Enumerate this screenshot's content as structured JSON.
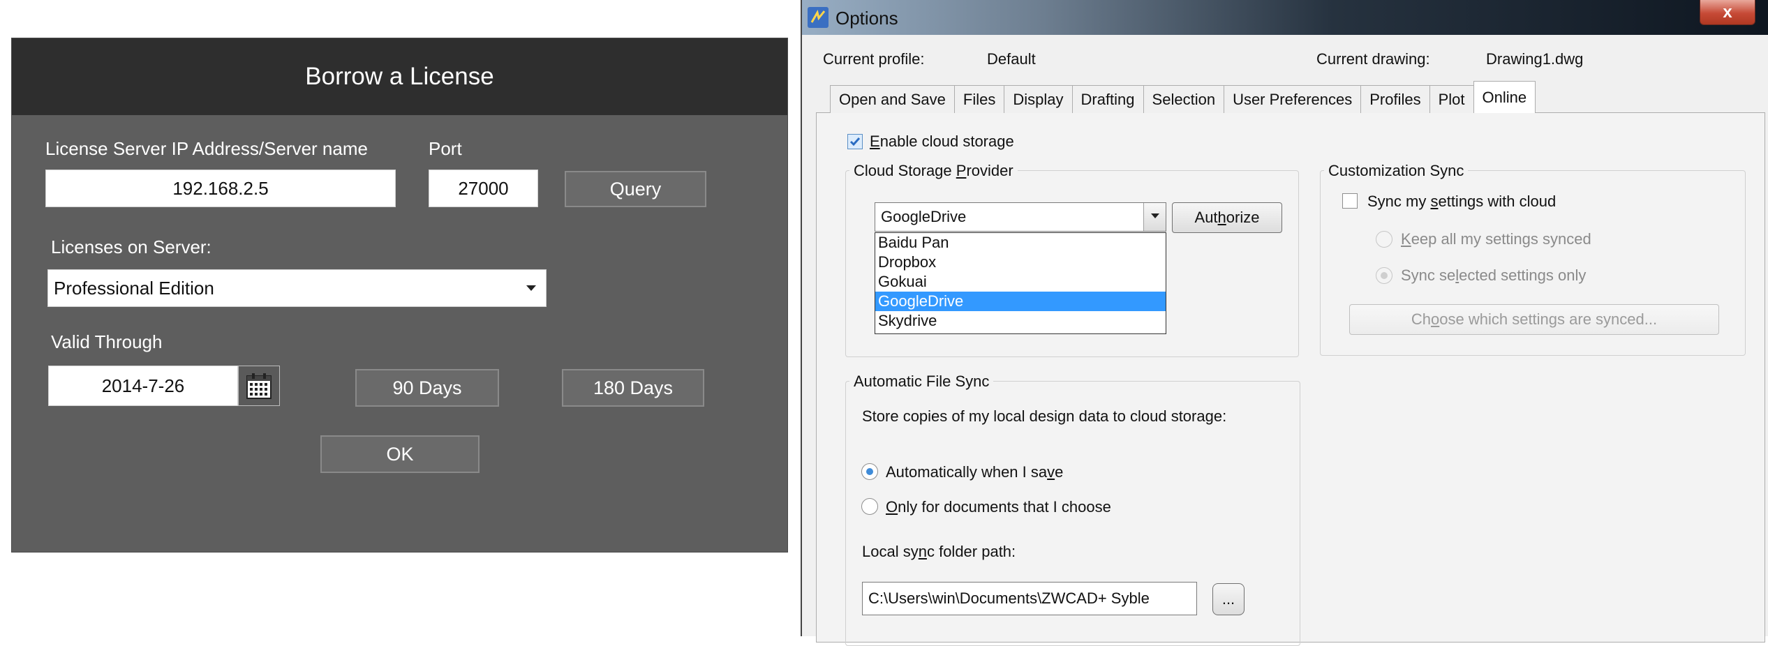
{
  "borrow": {
    "title": "Borrow a License",
    "server_label": "License Server IP Address/Server name",
    "port_label": "Port",
    "server_value": "192.168.2.5",
    "port_value": "27000",
    "query_button": "Query",
    "licenses_label": "Licenses on Server:",
    "license_selected": "Professional Edition",
    "valid_label": "Valid Through",
    "date_value": "2014-7-26",
    "days90_button": "90 Days",
    "days180_button": "180 Days",
    "ok_button": "OK"
  },
  "options": {
    "window_title": "Options",
    "close_glyph": "x",
    "current_profile_label": "Current profile:",
    "current_profile_value": "Default",
    "current_drawing_label": "Current drawing:",
    "current_drawing_value": "Drawing1.dwg",
    "tabs": [
      "Open and Save",
      "Files",
      "Display",
      "Drafting",
      "Selection",
      "User Preferences",
      "Profiles",
      "Plot",
      "Online"
    ],
    "active_tab": "Online",
    "enable_cloud": {
      "pre": "",
      "key": "E",
      "post": "nable cloud storage",
      "checked": true
    },
    "cloud_provider": {
      "legend_pre": "Cloud Storage ",
      "legend_key": "P",
      "legend_post": "rovider",
      "selected": "GoogleDrive",
      "options": [
        "Baidu Pan",
        "Dropbox",
        "Gokuai",
        "GoogleDrive",
        "Skydrive"
      ],
      "authorize_pre": "Aut",
      "authorize_key": "h",
      "authorize_post": "orize"
    },
    "customization_sync": {
      "legend": "Customization Sync",
      "sync_pre": "Sync my ",
      "sync_key": "s",
      "sync_post": "ettings with cloud",
      "keep_pre": "",
      "keep_key": "K",
      "keep_post": "eep all my settings synced",
      "selected_pre": "Sync se",
      "selected_key": "l",
      "selected_post": "ected settings only",
      "choose_pre": "Ch",
      "choose_key": "o",
      "choose_post": "ose which settings are synced..."
    },
    "auto_sync": {
      "legend": "Automatic File Sync",
      "store_text": "Store copies of my local design data to cloud storage:",
      "auto_pre": "Automatically when I sa",
      "auto_key": "v",
      "auto_post": "e",
      "only_pre": "",
      "only_key": "O",
      "only_post": "nly for documents that I choose",
      "folder_pre": "Local sy",
      "folder_key": "n",
      "folder_post": "c folder path:",
      "folder_value": "C:\\Users\\win\\Documents\\ZWCAD+ Syble",
      "browse_button": "..."
    }
  }
}
